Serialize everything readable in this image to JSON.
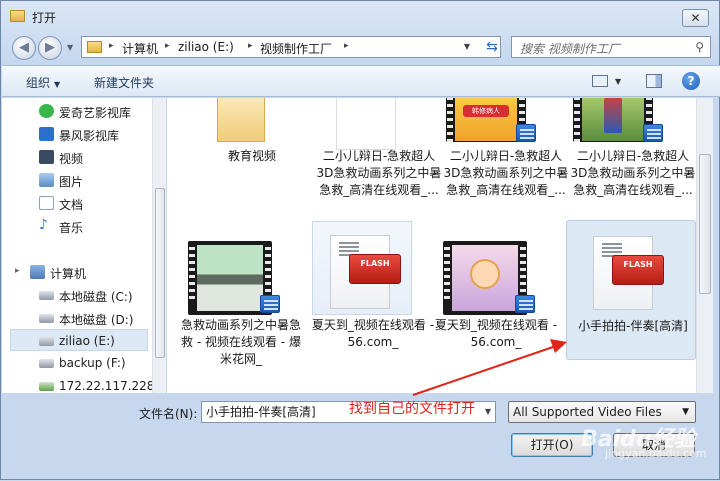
{
  "window": {
    "title": "打开",
    "close_glyph": "✕"
  },
  "address": {
    "crumbs": [
      "计算机",
      "ziliao (E:)",
      "视频制作工厂"
    ]
  },
  "search": {
    "placeholder": "搜索 视频制作工厂"
  },
  "toolbar": {
    "organize": "组织",
    "new_folder": "新建文件夹"
  },
  "sidebar": {
    "items": [
      {
        "label": "爱奇艺影视库",
        "icon": "iqiyi-icon",
        "color": "#39b54a"
      },
      {
        "label": "暴风影视库",
        "icon": "baofeng-icon",
        "color": "#2b6fcf"
      },
      {
        "label": "视频",
        "icon": "video-library-icon",
        "color": "#3a4a63"
      },
      {
        "label": "图片",
        "icon": "pictures-library-icon",
        "color": "#5b8cc4"
      },
      {
        "label": "文档",
        "icon": "documents-library-icon",
        "color": "#8aa0bb"
      },
      {
        "label": "音乐",
        "icon": "music-library-icon",
        "color": "#2f7ad9"
      },
      {
        "label": "计算机",
        "icon": "computer-icon",
        "color": "#4e79b4"
      },
      {
        "label": "本地磁盘 (C:)",
        "icon": "drive-c-icon",
        "color": "#8f99a6"
      },
      {
        "label": "本地磁盘 (D:)",
        "icon": "drive-d-icon",
        "color": "#8f99a6"
      },
      {
        "label": "ziliao (E:)",
        "icon": "drive-e-icon",
        "color": "#8f99a6"
      },
      {
        "label": "backup (F:)",
        "icon": "drive-f-icon",
        "color": "#8f99a6"
      },
      {
        "label": "172.22.117.228",
        "icon": "network-drive-icon",
        "color": "#5aa04a"
      }
    ]
  },
  "files": [
    {
      "name": "教育视频",
      "type": "folder"
    },
    {
      "name": "二小儿辩日-急救超人3D急救动画系列之中暑急救_高清在线观看_...",
      "type": "blank"
    },
    {
      "name": "二小儿辩日-急救超人3D急救动画系列之中暑急救_高清在线观看_...",
      "type": "video-cartoon",
      "thumb_text": "韩修病人"
    },
    {
      "name": "二小儿辩日-急救超人3D急救动画系列之中暑急救_高清在线观看_...",
      "type": "video-hero"
    },
    {
      "name": "急救动画系列之中暑急救 - 视频在线观看 - 爆米花网_",
      "type": "video-car"
    },
    {
      "name": "夏天到_视频在线观看 - 56.com_",
      "type": "flash",
      "badge": "FLASH"
    },
    {
      "name": "夏天到_视频在线观看 - 56.com_",
      "type": "video-baby"
    },
    {
      "name": "小手拍拍-伴奏[高清]",
      "type": "flash",
      "badge": "FLASH"
    }
  ],
  "filename": {
    "label": "文件名(N):",
    "value": "小手拍拍-伴奏[高清]"
  },
  "filetype": {
    "value": "All Supported Video Files"
  },
  "buttons": {
    "open": "打开(O)",
    "cancel": "取消"
  },
  "annotation": {
    "text": "找到自己的文件打开",
    "color": "#e2231a"
  },
  "watermark": {
    "text": "Baidu经验",
    "sub": "jingyan.baidu.com"
  }
}
